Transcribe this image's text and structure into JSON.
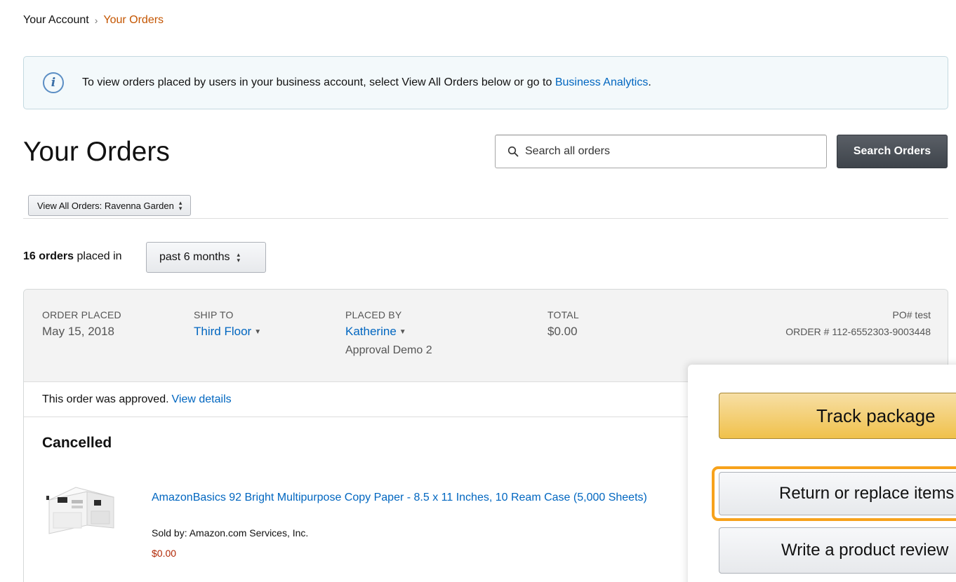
{
  "breadcrumb": {
    "parent": "Your Account",
    "separator": "›",
    "current": "Your Orders"
  },
  "info": {
    "icon": "info-icon",
    "text": "To view orders placed by users in your business account, select View All Orders below or go to ",
    "link": "Business Analytics",
    "suffix": "."
  },
  "page": {
    "title": "Your Orders"
  },
  "search": {
    "placeholder": "Search all orders",
    "value": "",
    "button_label": "Search Orders"
  },
  "view_all": {
    "label": "View All Orders: Ravenna Garden"
  },
  "orders_summary": {
    "count": "16 orders",
    "placed_in": " placed in",
    "period": "past 6 months"
  },
  "order": {
    "order_placed_label": "ORDER PLACED",
    "order_placed_value": "May 15, 2018",
    "ship_to_label": "SHIP TO",
    "ship_to_value": "Third Floor",
    "placed_by_label": "PLACED BY",
    "placed_by_value": "Katherine",
    "placed_by_sub": "Approval Demo 2",
    "total_label": "TOTAL",
    "total_value": "$0.00",
    "po": "PO# test",
    "order_number": "ORDER # 112-6552303-9003448",
    "approved_text": "This order was approved.",
    "view_details": "View details",
    "status": "Cancelled",
    "item": {
      "title": "AmazonBasics 92 Bright Multipurpose Copy Paper - 8.5 x 11 Inches, 10 Ream Case (5,000 Sheets)",
      "sold_by": "Sold by: Amazon.com Services, Inc.",
      "price": "$0.00"
    }
  },
  "actions": {
    "track": "Track package",
    "return": "Return or replace items",
    "review": "Write a product review"
  },
  "colors": {
    "link": "#0066c0",
    "breadcrumb_current": "#c45500",
    "price": "#b12704",
    "track_button": "#f0c14b",
    "focus_ring": "#f7a21b"
  }
}
